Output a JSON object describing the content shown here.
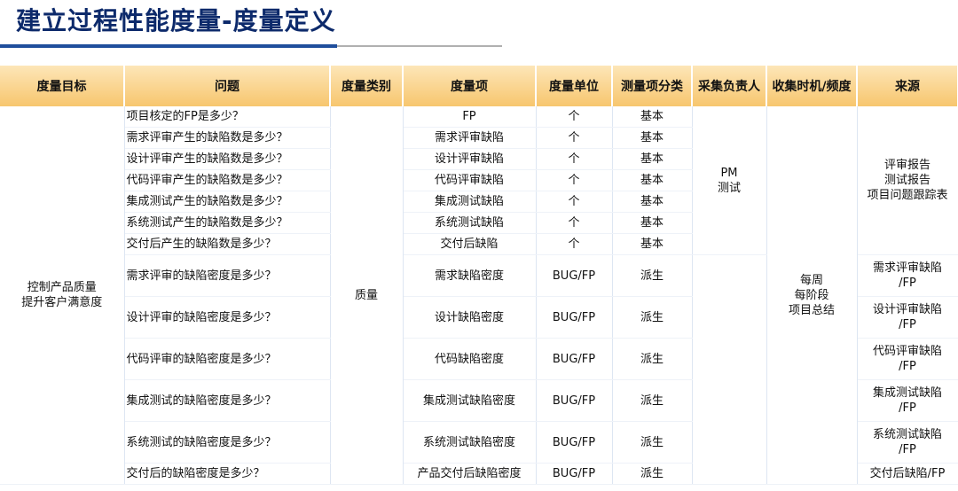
{
  "title": "建立过程性能度量-度量定义",
  "headers": [
    "度量目标",
    "问题",
    "度量类别",
    "度量项",
    "度量单位",
    "测量项分类",
    "采集负责人",
    "收集时机/频度",
    "来源"
  ],
  "goal": [
    "控制产品质量",
    "提升客户满意度"
  ],
  "category": "质量",
  "collector": [
    "PM",
    "测试"
  ],
  "timing": [
    "每周",
    "每阶段",
    "项目总结"
  ],
  "base_source": [
    "评审报告",
    "测试报告",
    "项目问题跟踪表"
  ],
  "rows": [
    {
      "question": "项目核定的FP是多少？",
      "item": "FP",
      "unit": "个",
      "class": "基本"
    },
    {
      "question": "需求评审产生的缺陷数是多少？",
      "item": "需求评审缺陷",
      "unit": "个",
      "class": "基本"
    },
    {
      "question": "设计评审产生的缺陷数是多少？",
      "item": "设计评审缺陷",
      "unit": "个",
      "class": "基本"
    },
    {
      "question": "代码评审产生的缺陷数是多少？",
      "item": "代码评审缺陷",
      "unit": "个",
      "class": "基本"
    },
    {
      "question": "集成测试产生的缺陷数是多少？",
      "item": "集成测试缺陷",
      "unit": "个",
      "class": "基本"
    },
    {
      "question": "系统测试产生的缺陷数是多少？",
      "item": "系统测试缺陷",
      "unit": "个",
      "class": "基本"
    },
    {
      "question": "交付后产生的缺陷数是多少？",
      "item": "交付后缺陷",
      "unit": "个",
      "class": "基本"
    },
    {
      "question": "需求评审的缺陷密度是多少？",
      "item": "需求缺陷密度",
      "unit": "BUG/FP",
      "class": "派生",
      "source": [
        "需求评审缺陷",
        "/FP"
      ]
    },
    {
      "question": "设计评审的缺陷密度是多少？",
      "item": "设计缺陷密度",
      "unit": "BUG/FP",
      "class": "派生",
      "source": [
        "设计评审缺陷",
        "/FP"
      ]
    },
    {
      "question": "代码评审的缺陷密度是多少？",
      "item": "代码缺陷密度",
      "unit": "BUG/FP",
      "class": "派生",
      "source": [
        "代码评审缺陷",
        "/FP"
      ]
    },
    {
      "question": "集成测试的缺陷密度是多少？",
      "item": "集成测试缺陷密度",
      "unit": "BUG/FP",
      "class": "派生",
      "source": [
        "集成测试缺陷",
        "/FP"
      ]
    },
    {
      "question": "系统测试的缺陷密度是多少？",
      "item": "系统测试缺陷密度",
      "unit": "BUG/FP",
      "class": "派生",
      "source": [
        "系统测试缺陷",
        "/FP"
      ]
    },
    {
      "question": "交付后的缺陷密度是多少？",
      "item": "产品交付后缺陷密度",
      "unit": "BUG/FP",
      "class": "派生",
      "source": [
        "交付后缺陷/FP"
      ]
    }
  ]
}
